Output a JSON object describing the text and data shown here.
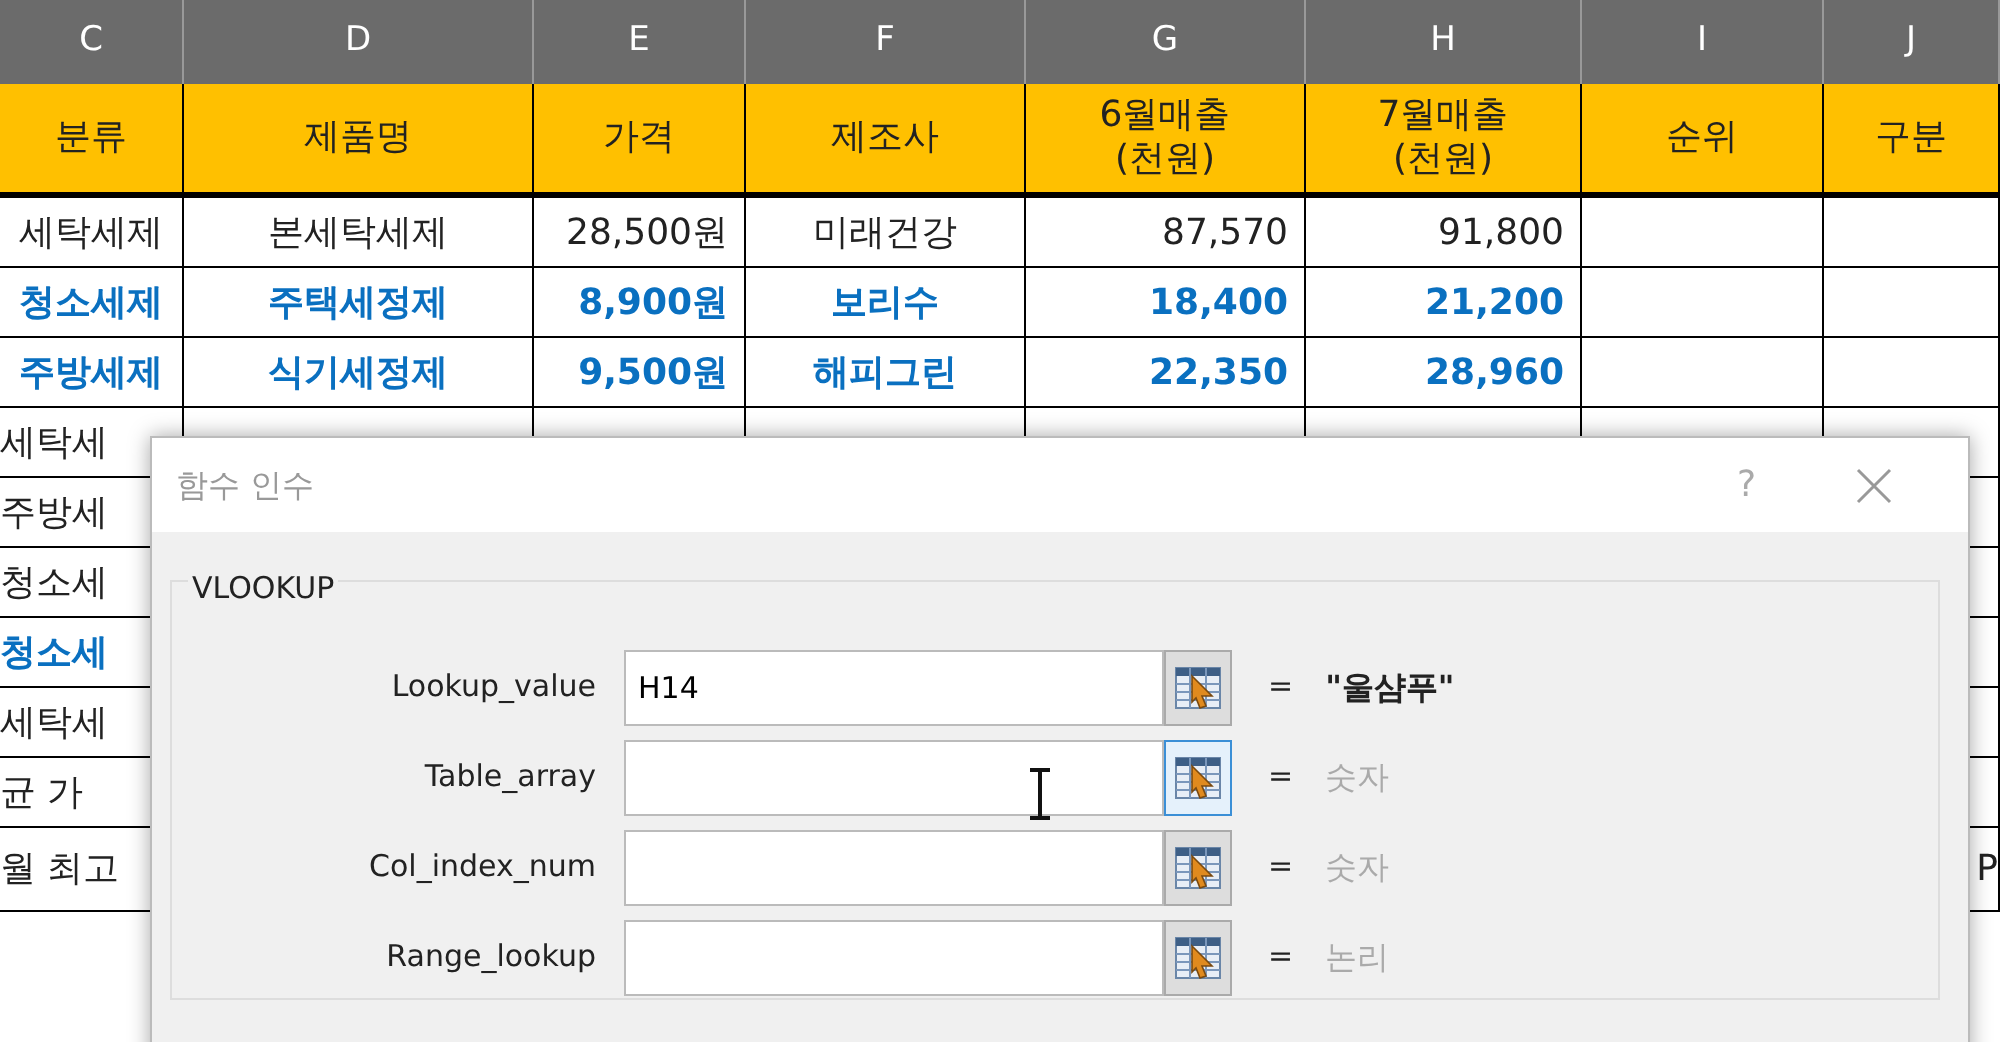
{
  "sheet": {
    "columns": [
      "C",
      "D",
      "E",
      "F",
      "G",
      "H",
      "I",
      "J"
    ],
    "header": [
      "분류",
      "제품명",
      "가격",
      "제조사",
      "6월매출\n(천원)",
      "7월매출\n(천원)",
      "순위",
      "구분"
    ],
    "rows": [
      {
        "highlight": false,
        "cells": [
          "세탁세제",
          "본세탁세제",
          "28,500원",
          "미래건강",
          "87,570",
          "91,800",
          "",
          ""
        ]
      },
      {
        "highlight": true,
        "cells": [
          "청소세제",
          "주택세정제",
          "8,900원",
          "보리수",
          "18,400",
          "21,200",
          "",
          ""
        ]
      },
      {
        "highlight": true,
        "cells": [
          "주방세제",
          "식기세정제",
          "9,500원",
          "해피그린",
          "22,350",
          "28,960",
          "",
          ""
        ]
      },
      {
        "highlight": false,
        "cells": [
          "세탁세",
          "",
          "",
          "",
          "",
          "",
          "",
          ""
        ]
      },
      {
        "highlight": false,
        "cells": [
          "주방세",
          "",
          "",
          "",
          "",
          "",
          "",
          ""
        ]
      },
      {
        "highlight": false,
        "cells": [
          "청소세",
          "",
          "",
          "",
          "",
          "",
          "",
          ""
        ]
      },
      {
        "highlight": true,
        "cells": [
          "청소세",
          "",
          "",
          "",
          "",
          "",
          "",
          ""
        ]
      },
      {
        "highlight": false,
        "cells": [
          "세탁세",
          "",
          "",
          "",
          "",
          "",
          "",
          ""
        ]
      },
      {
        "highlight": false,
        "cells": [
          "균 가",
          "",
          "",
          "",
          "",
          "",
          "",
          ""
        ]
      },
      {
        "highlight": false,
        "cells": [
          "월 최고",
          "",
          "",
          "",
          "",
          "",
          "",
          "P"
        ]
      }
    ]
  },
  "dialog": {
    "title": "함수 인수",
    "help": "?",
    "function": "VLOOKUP",
    "arguments": [
      {
        "label": "Lookup_value",
        "value": "H14",
        "focused": false,
        "result": "\"울샴푸\"",
        "greyed": false
      },
      {
        "label": "Table_array",
        "focused": true,
        "result": "숫자",
        "greyed": true
      },
      {
        "label": "Col_index_num",
        "focused": false,
        "result": "숫자",
        "greyed": true
      },
      {
        "label": "Range_lookup",
        "focused": false,
        "result": "논리",
        "greyed": true
      }
    ],
    "equals": "="
  }
}
